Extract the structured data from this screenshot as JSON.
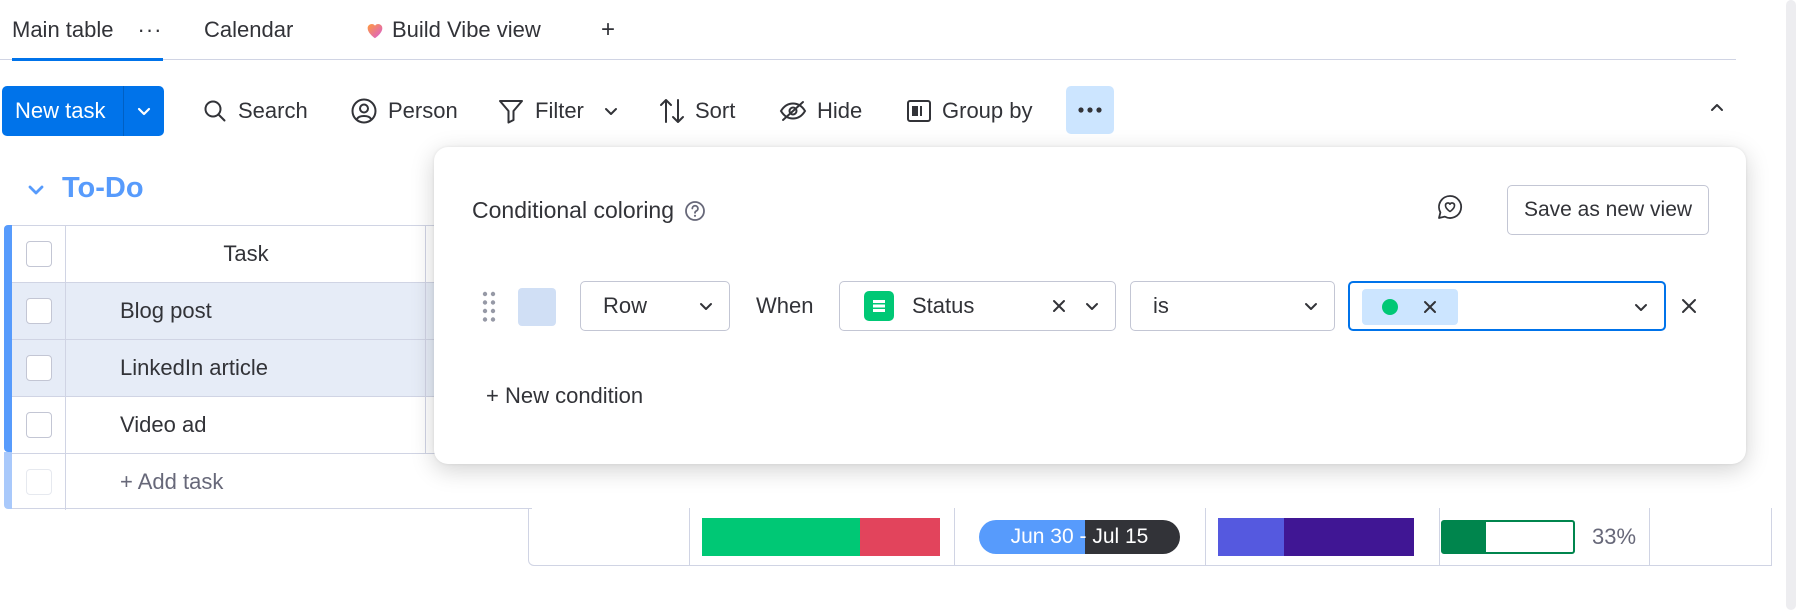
{
  "tabs": [
    {
      "label": "Main table",
      "more": "···"
    },
    {
      "label": "Calendar"
    },
    {
      "label": "Build Vibe view"
    },
    {
      "label": "+"
    }
  ],
  "toolbar": {
    "new_task": "New task",
    "search": "Search",
    "person": "Person",
    "filter": "Filter",
    "sort": "Sort",
    "hide": "Hide",
    "group_by": "Group by"
  },
  "group": {
    "title": "To-Do",
    "column_header": "Task",
    "items": [
      "Blog post",
      "LinkedIn article",
      "Video ad"
    ],
    "add_task": "+ Add task"
  },
  "summary": {
    "timeline": "Jun 30 - Jul 15",
    "progress_percent": 33,
    "progress_label": "33%"
  },
  "popover": {
    "title": "Conditional coloring",
    "save_view": "Save as new view",
    "condition": {
      "target": "Row",
      "when": "When",
      "column": "Status",
      "operator": "is"
    },
    "new_condition": "+ New condition"
  },
  "colors": {
    "primary": "#0073ea",
    "group": "#579bfc",
    "done_green": "#00c875",
    "stuck_red": "#e2445c",
    "progress_green": "#00854d",
    "timeline_dark": "#323338",
    "purple_1": "#5559df",
    "purple_2": "#401694"
  }
}
